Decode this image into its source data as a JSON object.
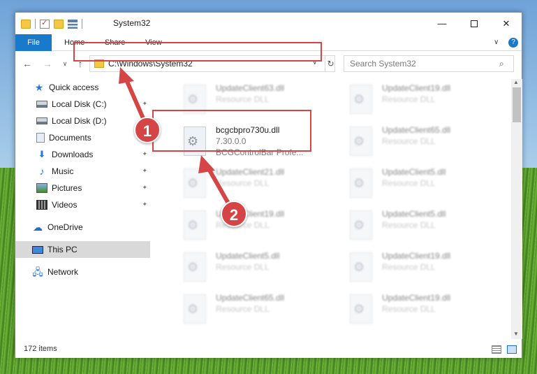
{
  "window": {
    "title": "System32",
    "controls": {
      "minimize": "—",
      "maximize": "",
      "close": "✕"
    }
  },
  "ribbon": {
    "tabs": [
      "File",
      "Home",
      "Share",
      "View"
    ],
    "expand": "∨",
    "help": "?"
  },
  "nav": {
    "back": "←",
    "forward": "→",
    "recent": "∨",
    "up": "↑",
    "address": "C:\\Windows\\System32",
    "address_dropdown": "∨",
    "refresh": "↻",
    "search_placeholder": "Search System32",
    "search_icon": "⌕"
  },
  "sidebar": {
    "items": [
      {
        "label": "Quick access",
        "icon": "star-icon",
        "pinned": false
      },
      {
        "label": "Local Disk (C:)",
        "icon": "disk-icon",
        "pinned": true
      },
      {
        "label": "Local Disk (D:)",
        "icon": "disk-icon",
        "pinned": true
      },
      {
        "label": "Documents",
        "icon": "document-icon",
        "pinned": true
      },
      {
        "label": "Downloads",
        "icon": "download-icon",
        "pinned": true
      },
      {
        "label": "Music",
        "icon": "music-icon",
        "pinned": true
      },
      {
        "label": "Pictures",
        "icon": "pictures-icon",
        "pinned": true
      },
      {
        "label": "Videos",
        "icon": "videos-icon",
        "pinned": true
      },
      {
        "label": "OneDrive",
        "icon": "onedrive-icon",
        "pinned": false
      },
      {
        "label": "This PC",
        "icon": "pc-icon",
        "pinned": false
      },
      {
        "label": "Network",
        "icon": "network-icon",
        "pinned": false
      }
    ],
    "pin_glyph": "📌"
  },
  "files": {
    "highlighted": {
      "name": "bcgcbpro730u.dll",
      "version": "7.30.0.0",
      "description": "BCGControlBar Profe..."
    },
    "others": [
      {
        "name": "UpdateClient63.dll",
        "desc": "Resource DLL"
      },
      {
        "name": "UpdateClient19.dll",
        "desc": "Resource DLL"
      },
      {
        "name": "UpdateClient65.dll",
        "desc": "Resource DLL"
      },
      {
        "name": "UpdateClient21.dll",
        "desc": "Resource DLL"
      },
      {
        "name": "UpdateClient5.dll",
        "desc": "Resource DLL"
      },
      {
        "name": "UpdateClient19.dll",
        "desc": "Resource DLL"
      },
      {
        "name": "UpdateClient5.dll",
        "desc": "Resource DLL"
      },
      {
        "name": "UpdateClient5.dll",
        "desc": "Resource DLL"
      },
      {
        "name": "UpdateClient19.dll",
        "desc": "Resource DLL"
      },
      {
        "name": "UpdateClient65.dll",
        "desc": "Resource DLL"
      },
      {
        "name": "UpdateClient19.dll",
        "desc": "Resource DLL"
      }
    ]
  },
  "status": {
    "item_count": "172 items"
  },
  "callouts": {
    "step1": "1",
    "step2": "2"
  },
  "colors": {
    "accent": "#1979ca",
    "highlight": "#d64545",
    "selected": "#d9d9d9"
  }
}
